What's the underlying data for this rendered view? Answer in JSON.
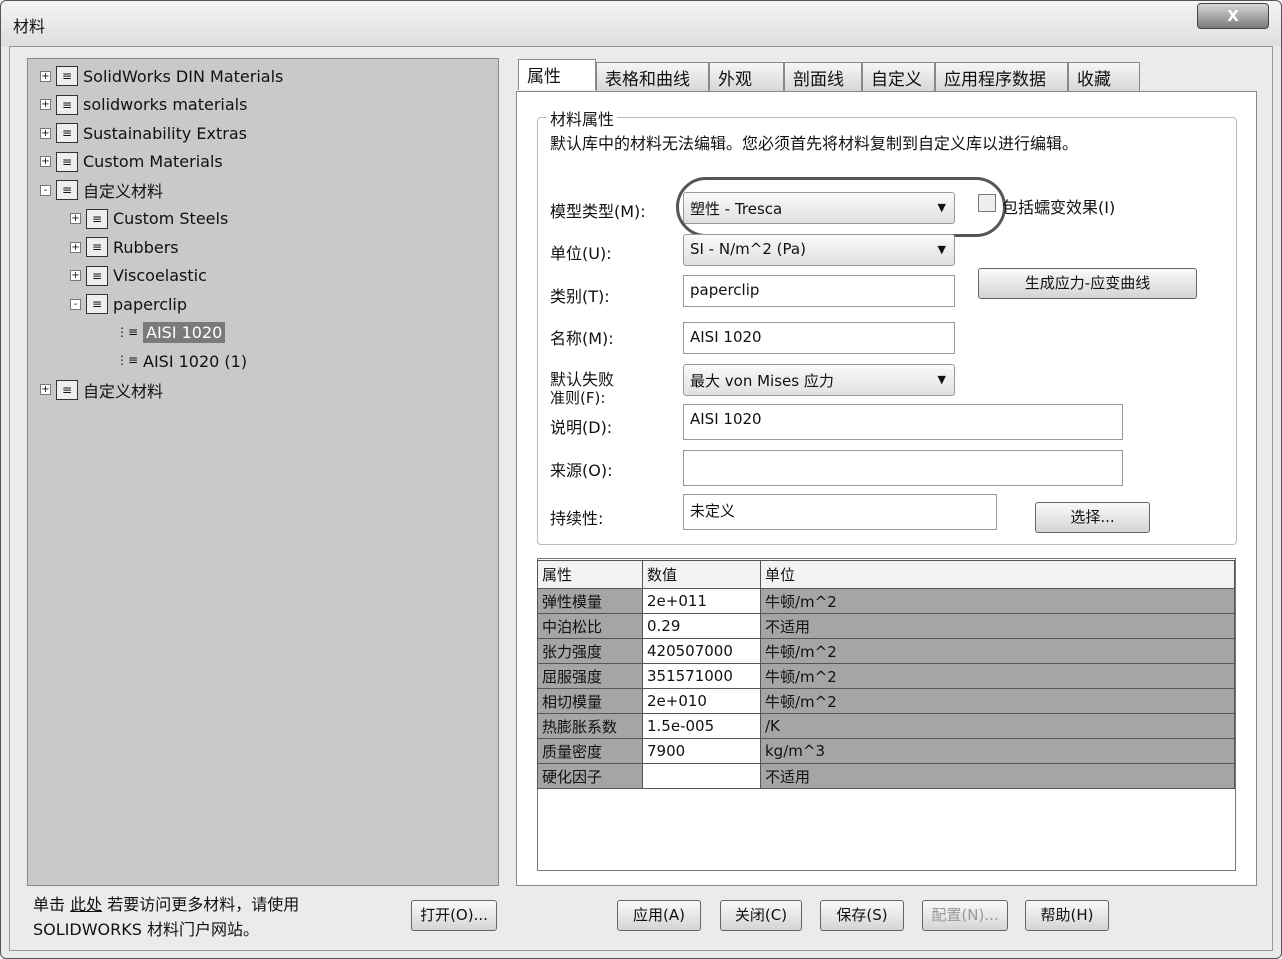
{
  "window": {
    "title": "材料",
    "close": "X"
  },
  "tree": [
    {
      "label": "SolidWorks DIN Materials",
      "exp": "+"
    },
    {
      "label": "solidworks materials",
      "exp": "+"
    },
    {
      "label": "Sustainability Extras",
      "exp": "+"
    },
    {
      "label": "Custom Materials",
      "exp": "+"
    },
    {
      "label": "自定义材料",
      "exp": "-"
    },
    {
      "label": "Custom Steels",
      "exp": "+"
    },
    {
      "label": "Rubbers",
      "exp": "+"
    },
    {
      "label": "Viscoelastic",
      "exp": "+"
    },
    {
      "label": "paperclip",
      "exp": "-"
    },
    {
      "label": "AISI 1020",
      "selected": true
    },
    {
      "label": "AISI 1020 (1)"
    },
    {
      "label": "自定义材料",
      "exp": "+"
    }
  ],
  "tabs": [
    "属性",
    "表格和曲线",
    "外观",
    "剖面线",
    "自定义",
    "应用程序数据",
    "收藏"
  ],
  "props": {
    "group_title": "材料属性",
    "notice": "默认库中的材料无法编辑。您必须首先将材料复制到自定义库以进行编辑。",
    "model_type_label": "模型类型(M):",
    "model_type": "塑性 - Tresca",
    "creep_label": "包括蠕变效果(I)",
    "units_label": "单位(U):",
    "units": "SI - N/m^2 (Pa)",
    "category_label": "类别(T):",
    "category": "paperclip",
    "curve_button": "生成应力-应变曲线",
    "name_label": "名称(M):",
    "name": "AISI 1020",
    "failure_label": "默认失败\n准则(F):",
    "failure_label_1": "默认失败",
    "failure_label_2": "准则(F):",
    "failure": "最大 von Mises 应力",
    "desc_label": "说明(D):",
    "desc": "AISI 1020",
    "source_label": "来源(O):",
    "source": "",
    "sustain_label": "持续性:",
    "sustain": "未定义",
    "select_button": "选择..."
  },
  "table": {
    "headers": [
      "属性",
      "数值",
      "单位"
    ],
    "rows": [
      [
        "弹性模量",
        "2e+011",
        "牛顿/m^2"
      ],
      [
        "中泊松比",
        "0.29",
        "不适用"
      ],
      [
        "张力强度",
        "420507000",
        "牛顿/m^2"
      ],
      [
        "屈服强度",
        "351571000",
        "牛顿/m^2"
      ],
      [
        "相切模量",
        "2e+010",
        "牛顿/m^2"
      ],
      [
        "热膨胀系数",
        "1.5e-005",
        "/K"
      ],
      [
        "质量密度",
        "7900",
        "kg/m^3"
      ],
      [
        "硬化因子",
        "",
        "不适用"
      ]
    ]
  },
  "footer": {
    "hint_1": "单击 ",
    "hint_link": "此处",
    "hint_2": " 若要访问更多材料，请使用",
    "hint_3": "SOLIDWORKS 材料门户网站。",
    "open": "打开(O)...",
    "apply": "应用(A)",
    "close": "关闭(C)",
    "save": "保存(S)",
    "config": "配置(N)...",
    "help": "帮助(H)"
  }
}
